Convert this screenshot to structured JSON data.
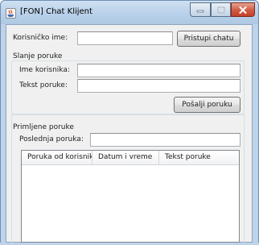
{
  "window": {
    "title": "[FON] Chat Klijent"
  },
  "login": {
    "username_label": "Korisničko ime:",
    "username_value": "",
    "connect_button": "Pristupi chatu"
  },
  "send_section": {
    "title": "Slanje poruke",
    "recipient_label": "Ime korisnika:",
    "recipient_value": "",
    "message_label": "Tekst poruke:",
    "message_value": "",
    "send_button": "Pošalji poruku"
  },
  "received_section": {
    "title": "Primljene poruke",
    "last_message_label": "Poslednja poruka:",
    "last_message_value": "",
    "table": {
      "columns": [
        "Poruka od korisnika",
        "Datum i vreme",
        "Tekst poruke"
      ],
      "rows": []
    }
  },
  "colors": {
    "title_bar": "#b9d1ea",
    "close_button": "#c7412a",
    "client_background": "#f0f0f0"
  }
}
